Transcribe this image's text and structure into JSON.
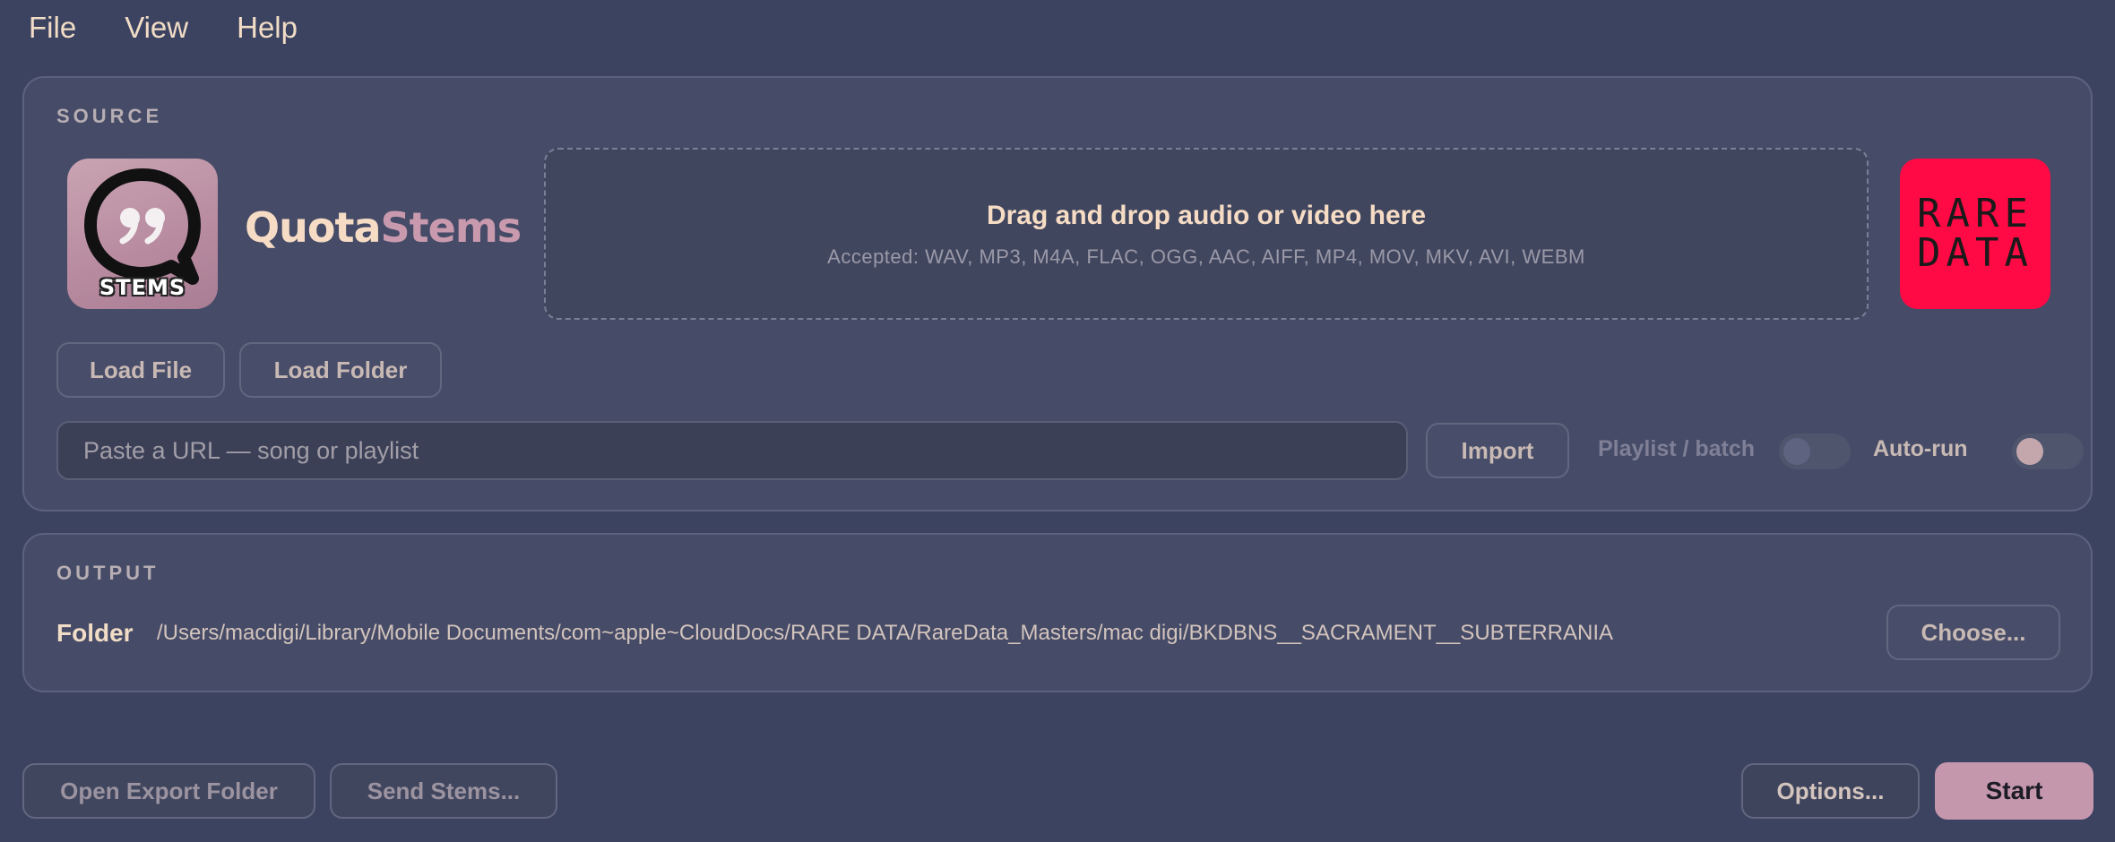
{
  "menu": {
    "file": "File",
    "view": "View",
    "help": "Help"
  },
  "source": {
    "section_label": "SOURCE",
    "app_icon_text": "STEMS",
    "brand_part1": "Quota",
    "brand_part2": "Stems",
    "drop_title": "Drag and drop audio or video here",
    "drop_subtitle": "Accepted: WAV, MP3, M4A, FLAC, OGG, AAC, AIFF, MP4, MOV, MKV, AVI, WEBM",
    "logo_line1": "RARE",
    "logo_line2": "DATA",
    "load_file_label": "Load File",
    "load_folder_label": "Load Folder",
    "url_placeholder": "Paste a URL — song or playlist",
    "url_value": "",
    "import_label": "Import",
    "playlist_label": "Playlist / batch",
    "playlist_on": false,
    "autorun_label": "Auto-run",
    "autorun_on": false
  },
  "output": {
    "section_label": "OUTPUT",
    "folder_label": "Folder",
    "folder_path": "/Users/macdigi/Library/Mobile Documents/com~apple~CloudDocs/RARE DATA/RareData_Masters/mac digi/BKDBNS__SACRAMENT__SUBTERRANIA",
    "choose_label": "Choose..."
  },
  "footer": {
    "open_export_label": "Open Export Folder",
    "send_stems_label": "Send Stems...",
    "options_label": "Options...",
    "start_label": "Start"
  },
  "icons": {
    "app_icon": "quote-bubble-icon",
    "logo": "rare-data-logo"
  },
  "colors": {
    "background": "#3c4360",
    "panel": "#464b67",
    "accent": "#c497ad",
    "logo_red": "#ff0a45",
    "text_primary": "#f6dcc4"
  }
}
